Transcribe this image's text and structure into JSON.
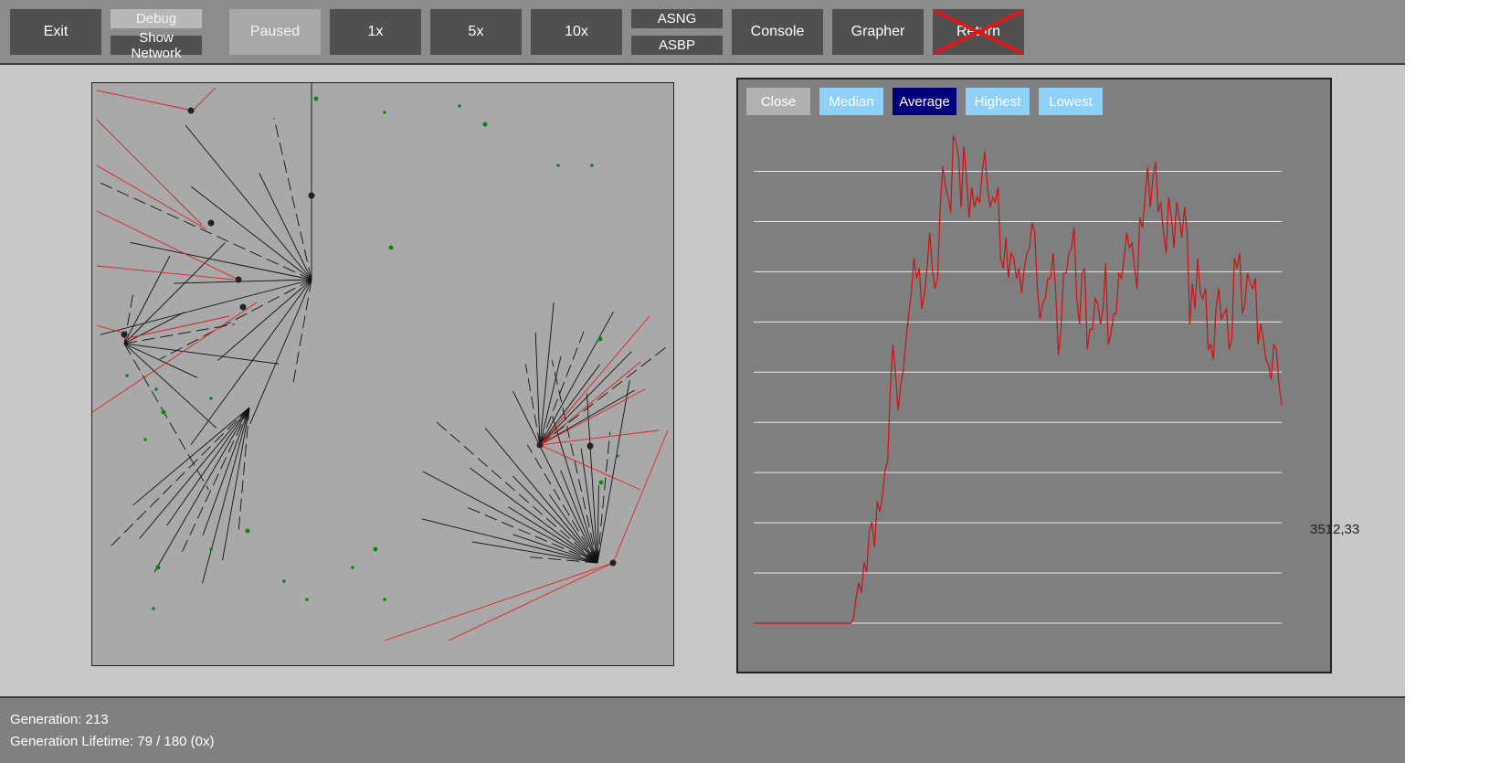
{
  "toolbar": {
    "exit": "Exit",
    "debug": "Debug",
    "show_network": "Show Network",
    "paused": "Paused",
    "speed_1x": "1x",
    "speed_5x": "5x",
    "speed_10x": "10x",
    "asng": "ASNG",
    "asbp": "ASBP",
    "console": "Console",
    "grapher": "Grapher",
    "return": "Return"
  },
  "grapher": {
    "close": "Close",
    "median": "Median",
    "average": "Average",
    "highest": "Highest",
    "lowest": "Lowest",
    "last_value_label": "3512,33",
    "active_mode": "Average",
    "line_color": "#cc1111"
  },
  "chart_data": {
    "type": "line",
    "series": [
      {
        "values": [
          0,
          0,
          0,
          0,
          0,
          0,
          0,
          0,
          0,
          0,
          0,
          0,
          0,
          0,
          0,
          0,
          0,
          0,
          0,
          0,
          0,
          0,
          0,
          0,
          0,
          0,
          0,
          0,
          0,
          0,
          0,
          0,
          0,
          0,
          0,
          0,
          0,
          0,
          0.1,
          0.5,
          0.8,
          0.6,
          1.2,
          1.0,
          1.8,
          2.0,
          1.5,
          2.4,
          2.2,
          2.5,
          3.0,
          3.2,
          4.6,
          5.5,
          4.9,
          4.2,
          4.7,
          5.0,
          5.6,
          6.1,
          6.5,
          7.2,
          6.8,
          7.0,
          6.2,
          6.5,
          7.0,
          7.7,
          7.0,
          6.6,
          6.8,
          8.2,
          9.0,
          8.6,
          8.4,
          8.1,
          9.6,
          9.5,
          9.2,
          8.2,
          9.4,
          8.8,
          8.0,
          8.6,
          8.2,
          8.4,
          8.3,
          8.9,
          9.3,
          8.6,
          8.2,
          8.4,
          8.3,
          8.6,
          7.2,
          7.0,
          7.6,
          6.8,
          7.3,
          7.2,
          6.8,
          7.0,
          6.5,
          7.0,
          7.3,
          7.4,
          7.9,
          7.7,
          6.6,
          6.0,
          6.3,
          6.4,
          6.8,
          6.8,
          7.3,
          6.5,
          5.3,
          5.8,
          6.9,
          6.9,
          7.3,
          7.4,
          7.8,
          6.4,
          5.9,
          6.9,
          7.0,
          5.4,
          5.8,
          5.8,
          6.4,
          6.3,
          5.9,
          6.2,
          7.1,
          5.5,
          5.7,
          6.1,
          6.1,
          6.9,
          6.8,
          7.2,
          7.7,
          7.4,
          7.5,
          7.0,
          6.6,
          8.0,
          7.8,
          8.4,
          9.0,
          8.2,
          8.8,
          9.1,
          8.1,
          8.3,
          7.7,
          7.3,
          8.4,
          8.0,
          7.4,
          8.3,
          8.0,
          7.6,
          8.2,
          7.7,
          5.9,
          6.7,
          6.2,
          7.2,
          6.5,
          6.4,
          6.6,
          5.4,
          5.5,
          5.2,
          6.2,
          6.6,
          6.0,
          6.1,
          6.2,
          5.4,
          5.6,
          7.2,
          7.0,
          7.3,
          6.1,
          6.3,
          6.9,
          6.7,
          6.6,
          6.8,
          5.5,
          5.9,
          5.6,
          5.2,
          5.1,
          4.8,
          5.5,
          5.4,
          4.7,
          4.3
        ],
        "last_value": "3512,33"
      }
    ],
    "grid": true,
    "ylim": [
      0,
      10
    ]
  },
  "status": {
    "generation": "Generation: 213",
    "lifetime": "Generation Lifetime: 79 / 180 (0x)"
  },
  "colors": {
    "toolbar_bg": "#8c8c8c",
    "button_bg": "#505050",
    "graph_bg": "#7f7f7f",
    "sim_bg": "#a9a9a9",
    "creature_edge_red": "#e02020",
    "food_green": "#0a8a0a",
    "average_btn": "#00007a",
    "option_btn": "#8fd0f8"
  }
}
